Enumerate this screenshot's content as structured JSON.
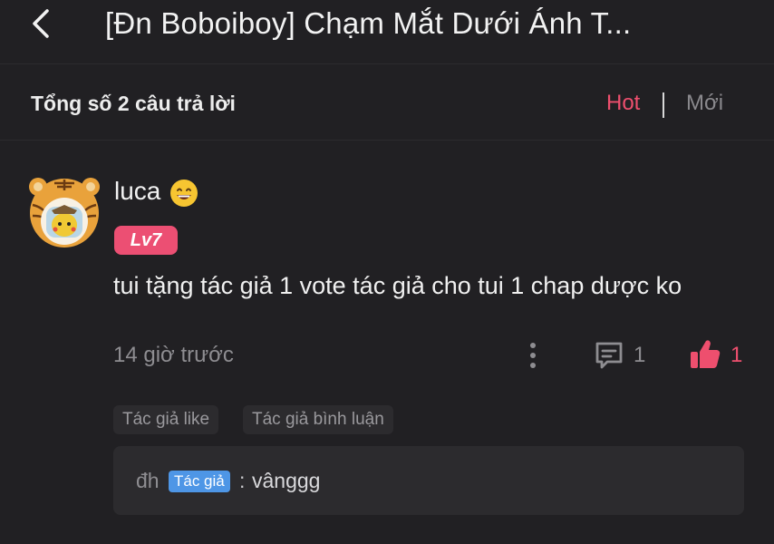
{
  "header": {
    "title": "[Đn Boboiboy] Chạm Mắt Dưới Ánh T..."
  },
  "subheader": {
    "total_label": "Tổng số 2 câu trả lời",
    "sort_hot": "Hot",
    "sort_new": "Mới",
    "active_sort": "Hot"
  },
  "comment": {
    "username": "luca",
    "level": "Lv7",
    "text": "tui tặng tác giả 1 vote tác giả cho tui 1 chap dược ko",
    "time": "14 giờ trước",
    "reply_count": "1",
    "like_count": "1",
    "tags": [
      "Tác giả like",
      "Tác giả bình luận"
    ]
  },
  "reply": {
    "author": "đh",
    "badge": "Tác giả",
    "separator": ":",
    "text": "vânggg"
  },
  "colors": {
    "background": "#212023",
    "accent": "#ee4f6e",
    "level_badge": "#ec4f73",
    "author_badge": "#4e96e6",
    "muted_text": "#8e8d91"
  }
}
